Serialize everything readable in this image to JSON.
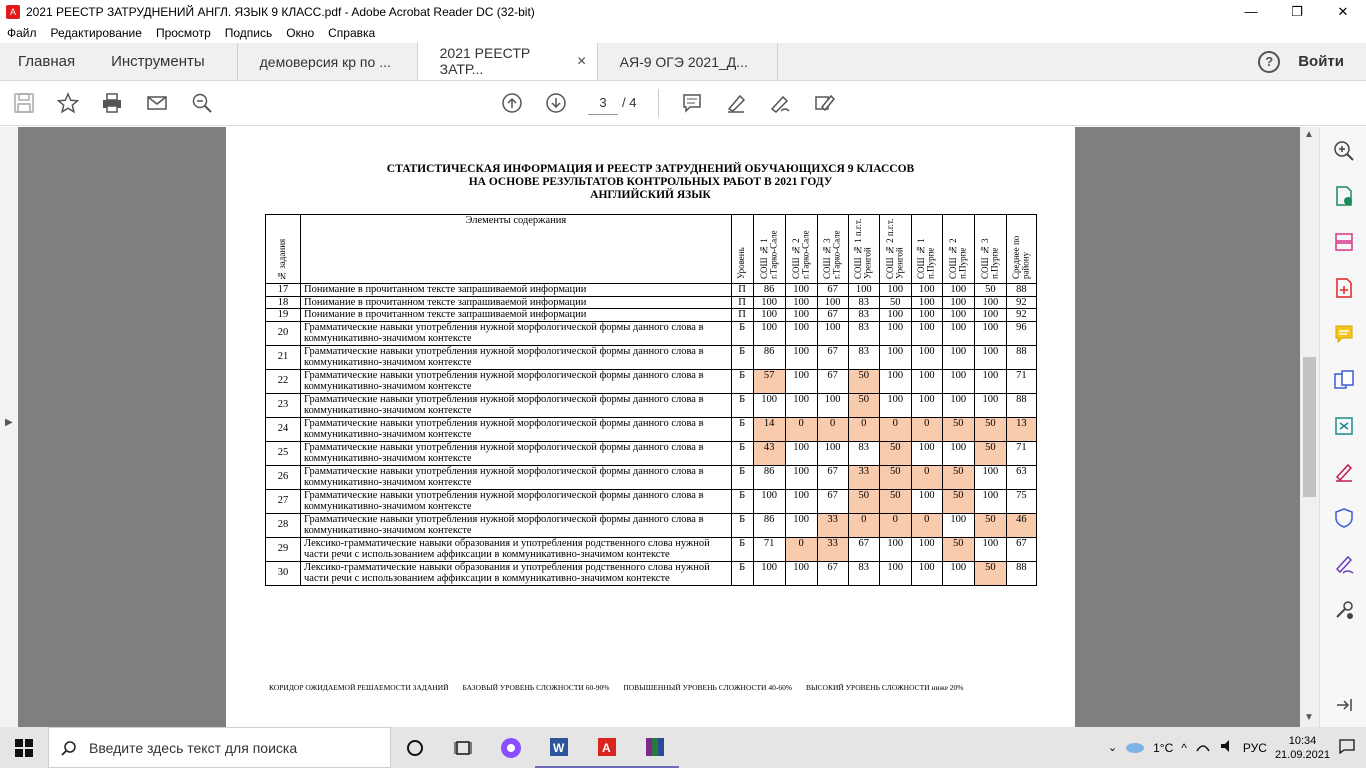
{
  "window": {
    "title": "2021 РЕЕСТР ЗАТРУДНЕНИЙ АНГЛ. ЯЗЫК 9 КЛАСС.pdf - Adobe Acrobat Reader DC (32-bit)"
  },
  "menu": [
    "Файл",
    "Редактирование",
    "Просмотр",
    "Подпись",
    "Окно",
    "Справка"
  ],
  "tabs": {
    "home": "Главная",
    "tools": "Инструменты",
    "docs": [
      {
        "label": "демоверсия кр по ..."
      },
      {
        "label": "2021 РЕЕСТР ЗАТР...",
        "active": true
      },
      {
        "label": "АЯ-9 ОГЭ 2021_Д..."
      }
    ],
    "signin": "Войти"
  },
  "toolbar": {
    "current_page": "3",
    "total_pages": "/ 4"
  },
  "document": {
    "heading": [
      "СТАТИСТИЧЕСКАЯ ИНФОРМАЦИЯ И РЕЕСТР ЗАТРУДНЕНИЙ ОБУЧАЮЩИХСЯ 9 КЛАССОВ",
      "НА ОСНОВЕ РЕЗУЛЬТАТОВ КОНТРОЛЬНЫХ РАБОТ В 2021 ГОДУ",
      "АНГЛИЙСКИЙ ЯЗЫК"
    ],
    "headers": {
      "num": "№ задания",
      "elements": "Элементы содержания",
      "level": "Уровень",
      "schools": [
        "СОШ № 1 г.Тарко-Сале",
        "СОШ № 2 г.Тарко-Сале",
        "СОШ № 3 г.Тарко-Сале",
        "СОШ № 1 п.г.т. Уренгой",
        "СОШ № 2 п.г.т. Уренгой",
        "СОШ № 1 п.Пурпе",
        "СОШ № 2 п.Пурпе",
        "СОШ № 3 п.Пурпе",
        "Среднее по району"
      ]
    },
    "rows": [
      {
        "num": "17",
        "text": "Понимание в прочитанном тексте запрашиваемой информации",
        "level": "П",
        "values": [
          "86",
          "100",
          "67",
          "100",
          "100",
          "100",
          "100",
          "50",
          "88"
        ],
        "hl": [
          0,
          0,
          0,
          0,
          0,
          0,
          0,
          0,
          0
        ]
      },
      {
        "num": "18",
        "text": "Понимание в прочитанном тексте запрашиваемой информации",
        "level": "П",
        "values": [
          "100",
          "100",
          "100",
          "83",
          "50",
          "100",
          "100",
          "100",
          "92"
        ],
        "hl": [
          0,
          0,
          0,
          0,
          0,
          0,
          0,
          0,
          0
        ]
      },
      {
        "num": "19",
        "text": "Понимание в прочитанном тексте запрашиваемой информации",
        "level": "П",
        "values": [
          "100",
          "100",
          "67",
          "83",
          "100",
          "100",
          "100",
          "100",
          "92"
        ],
        "hl": [
          0,
          0,
          0,
          0,
          0,
          0,
          0,
          0,
          0
        ]
      },
      {
        "num": "20",
        "text": "Грамматические навыки употребления нужной морфологической формы данного слова в коммуникативно-значимом контексте",
        "level": "Б",
        "values": [
          "100",
          "100",
          "100",
          "83",
          "100",
          "100",
          "100",
          "100",
          "96"
        ],
        "hl": [
          0,
          0,
          0,
          0,
          0,
          0,
          0,
          0,
          0
        ]
      },
      {
        "num": "21",
        "text": "Грамматические навыки употребления нужной морфологической формы данного слова в коммуникативно-значимом контексте",
        "level": "Б",
        "values": [
          "86",
          "100",
          "67",
          "83",
          "100",
          "100",
          "100",
          "100",
          "88"
        ],
        "hl": [
          0,
          0,
          0,
          0,
          0,
          0,
          0,
          0,
          0
        ]
      },
      {
        "num": "22",
        "text": "Грамматические навыки употребления нужной морфологической формы данного слова в коммуникативно-значимом контексте",
        "level": "Б",
        "values": [
          "57",
          "100",
          "67",
          "50",
          "100",
          "100",
          "100",
          "100",
          "71"
        ],
        "hl": [
          1,
          0,
          0,
          1,
          0,
          0,
          0,
          0,
          0
        ]
      },
      {
        "num": "23",
        "text": "Грамматические навыки употребления нужной морфологической формы данного слова в коммуникативно-значимом контексте",
        "level": "Б",
        "values": [
          "100",
          "100",
          "100",
          "50",
          "100",
          "100",
          "100",
          "100",
          "88"
        ],
        "hl": [
          0,
          0,
          0,
          1,
          0,
          0,
          0,
          0,
          0
        ]
      },
      {
        "num": "24",
        "text": "Грамматические навыки употребления нужной морфологической формы данного слова в коммуникативно-значимом контексте",
        "level": "Б",
        "values": [
          "14",
          "0",
          "0",
          "0",
          "0",
          "0",
          "50",
          "50",
          "13"
        ],
        "hl": [
          1,
          1,
          1,
          1,
          1,
          1,
          1,
          1,
          1
        ]
      },
      {
        "num": "25",
        "text": "Грамматические навыки употребления нужной морфологической формы данного слова в коммуникативно-значимом контексте",
        "level": "Б",
        "values": [
          "43",
          "100",
          "100",
          "83",
          "50",
          "100",
          "100",
          "50",
          "71"
        ],
        "hl": [
          1,
          0,
          0,
          0,
          1,
          0,
          0,
          1,
          0
        ]
      },
      {
        "num": "26",
        "text": "Грамматические навыки употребления нужной морфологической формы данного слова в коммуникативно-значимом контексте",
        "level": "Б",
        "values": [
          "86",
          "100",
          "67",
          "33",
          "50",
          "0",
          "50",
          "100",
          "63"
        ],
        "hl": [
          0,
          0,
          0,
          1,
          1,
          1,
          1,
          0,
          0
        ]
      },
      {
        "num": "27",
        "text": "Грамматические навыки употребления нужной морфологической формы данного слова в коммуникативно-значимом контексте",
        "level": "Б",
        "values": [
          "100",
          "100",
          "67",
          "50",
          "50",
          "100",
          "50",
          "100",
          "75"
        ],
        "hl": [
          0,
          0,
          0,
          1,
          1,
          0,
          1,
          0,
          0
        ]
      },
      {
        "num": "28",
        "text": "Грамматические навыки употребления нужной морфологической формы данного слова в коммуникативно-значимом контексте",
        "level": "Б",
        "values": [
          "86",
          "100",
          "33",
          "0",
          "0",
          "0",
          "100",
          "50",
          "46"
        ],
        "hl": [
          0,
          0,
          1,
          1,
          1,
          1,
          0,
          1,
          1
        ]
      },
      {
        "num": "29",
        "text": "Лексико-грамматические навыки образования и употребления родственного слова нужной части речи с использованием аффиксации в коммуникативно-значимом контексте",
        "level": "Б",
        "values": [
          "71",
          "0",
          "33",
          "67",
          "100",
          "100",
          "50",
          "100",
          "67"
        ],
        "hl": [
          0,
          1,
          1,
          0,
          0,
          0,
          1,
          0,
          0
        ]
      },
      {
        "num": "30",
        "text": "Лексико-грамматические навыки образования и употребления родственного слова нужной части речи с использованием аффиксации в коммуникативно-значимом контексте",
        "level": "Б",
        "values": [
          "100",
          "100",
          "67",
          "83",
          "100",
          "100",
          "100",
          "50",
          "88"
        ],
        "hl": [
          0,
          0,
          0,
          0,
          0,
          0,
          0,
          1,
          0
        ]
      }
    ],
    "legend": [
      "КОРИДОР ОЖИДАЕМОЙ РЕШАЕМОСТИ ЗАДАНИЙ",
      "БАЗОВЫЙ УРОВЕНЬ СЛОЖНОСТИ 60-90%",
      "ПОВЫШЕННЫЙ УРОВЕНЬ СЛОЖНОСТИ 40-60%",
      "ВЫСОКИЙ УРОВЕНЬ СЛОЖНОСТИ ниже 20%"
    ],
    "highlight_color": "#f8cbad"
  },
  "taskbar": {
    "search_placeholder": "Введите здесь текст для поиска",
    "weather": "1°C",
    "lang": "РУС",
    "time": "10:34",
    "date": "21.09.2021"
  }
}
